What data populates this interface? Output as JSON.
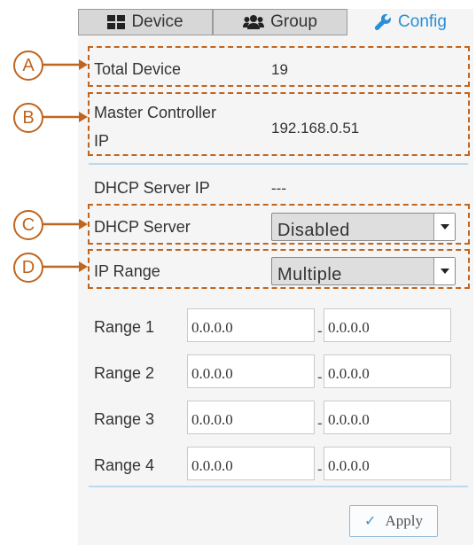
{
  "tabs": {
    "device": {
      "label": "Device",
      "icon": "grid-icon"
    },
    "group": {
      "label": "Group",
      "icon": "users-icon"
    },
    "config": {
      "label": "Config",
      "icon": "wrench-icon",
      "active": true
    }
  },
  "info": {
    "total_device": {
      "label": "Total Device",
      "value": "19"
    },
    "master_controller": {
      "label_line1": "Master Controller",
      "label_line2": "IP",
      "value": "192.168.0.51"
    },
    "dhcp_server_ip": {
      "label": "DHCP Server IP",
      "value": "---"
    }
  },
  "settings": {
    "dhcp_server": {
      "label": "DHCP Server",
      "selected": "Disabled"
    },
    "ip_range": {
      "label": "IP Range",
      "selected": "Multiple"
    }
  },
  "ranges": [
    {
      "label": "Range 1",
      "start": "0.0.0.0",
      "separator": "-",
      "end": "0.0.0.0"
    },
    {
      "label": "Range 2",
      "start": "0.0.0.0",
      "separator": "-",
      "end": "0.0.0.0"
    },
    {
      "label": "Range 3",
      "start": "0.0.0.0",
      "separator": "-",
      "end": "0.0.0.0"
    },
    {
      "label": "Range 4",
      "start": "0.0.0.0",
      "separator": "-",
      "end": "0.0.0.0"
    }
  ],
  "actions": {
    "apply_label": "Apply"
  },
  "callouts": [
    "A",
    "B",
    "C",
    "D"
  ],
  "colors": {
    "accent": "#2a8fd6",
    "callout": "#c0651f",
    "separator": "#bcd9ee"
  }
}
